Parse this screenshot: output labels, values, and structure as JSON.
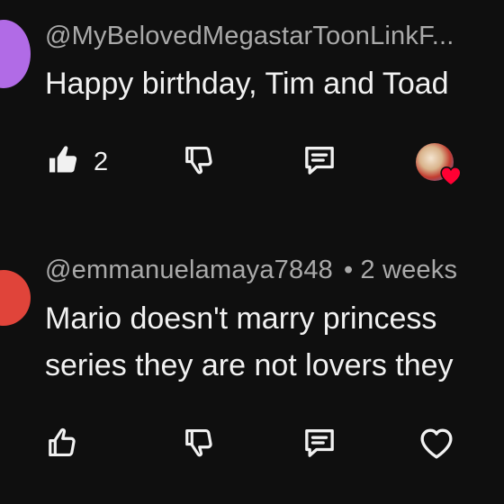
{
  "comments": [
    {
      "author": "@MyBelovedMegastarToonLinkF...",
      "text_lines": [
        "Happy birthday, Tim and Toad"
      ],
      "likes": "2",
      "liked": true,
      "creator_hearted": true,
      "avatar_color": "#a259d9"
    },
    {
      "author": "@emmanuelamaya7848",
      "separator": "•",
      "time": "2 weeks",
      "text_lines": [
        "Mario doesn't marry princess",
        "series they are not lovers they"
      ],
      "likes": "",
      "liked": false,
      "creator_hearted": false,
      "avatar_color": "#e0443a"
    }
  ],
  "icons": {
    "like": "thumbs-up-icon",
    "dislike": "thumbs-down-icon",
    "reply": "reply-icon",
    "heart": "heart-icon"
  },
  "colors": {
    "background": "#0f0f0f",
    "text": "#f1f1f1",
    "meta": "#aaaaaa",
    "heart": "#ff0033"
  }
}
